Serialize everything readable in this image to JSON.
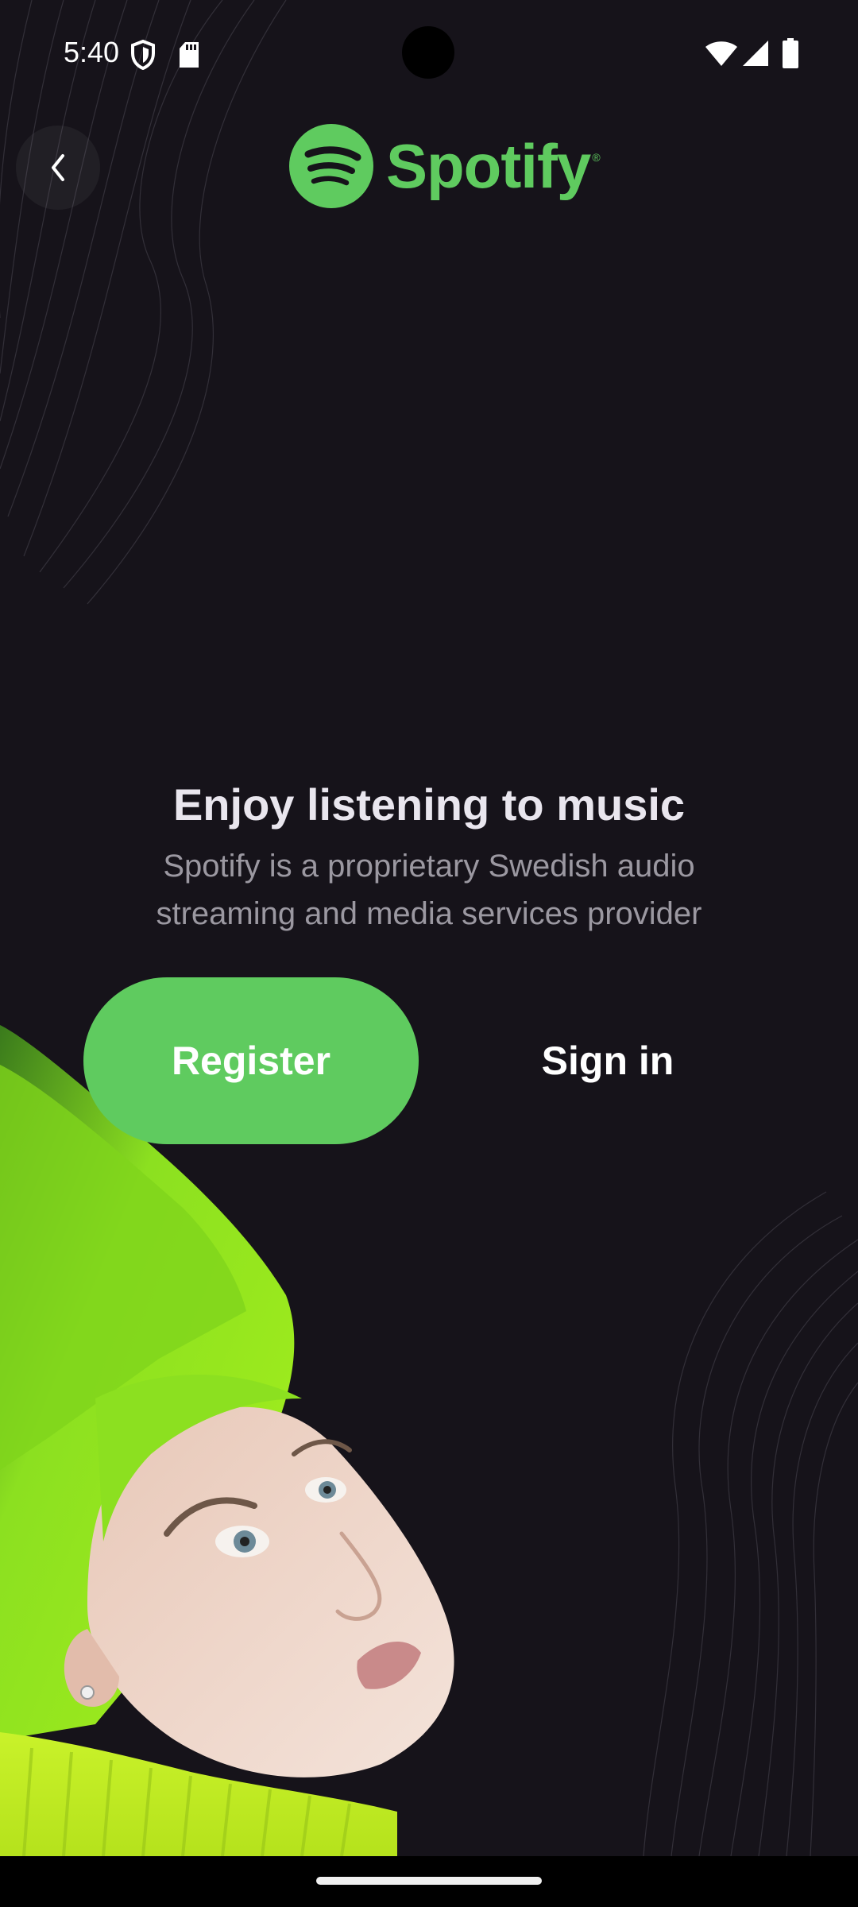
{
  "status_bar": {
    "time": "5:40",
    "icons": [
      "shield-icon",
      "sd-card-icon",
      "wifi-icon",
      "cellular-signal-icon",
      "battery-icon"
    ]
  },
  "header": {
    "back_icon": "chevron-left-icon",
    "brand_name": "Spotify",
    "brand_registered": "®"
  },
  "hero": {
    "title": "Enjoy listening to music",
    "description": "Spotify is a proprietary Swedish audio streaming and media services provider"
  },
  "actions": {
    "register_label": "Register",
    "signin_label": "Sign in"
  },
  "colors": {
    "background": "#16131a",
    "accent": "#5fcb5f",
    "title": "#e9e6ee",
    "description": "#9b98a1"
  }
}
